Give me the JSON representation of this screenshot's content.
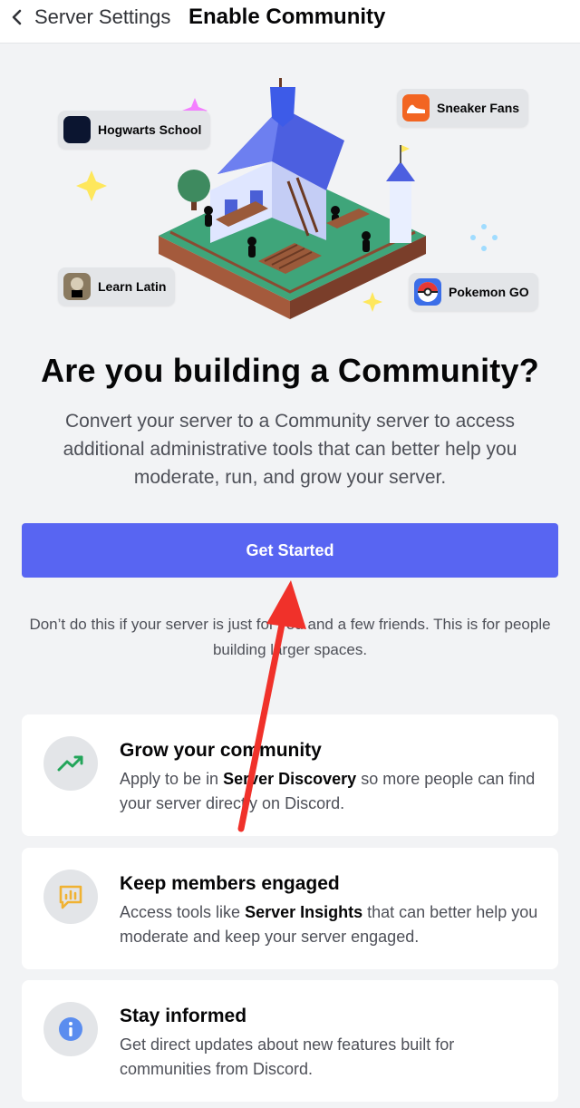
{
  "header": {
    "back_label": "Server Settings",
    "title": "Enable Community"
  },
  "hero": {
    "chips": [
      {
        "label": "Hogwarts School"
      },
      {
        "label": "Sneaker Fans"
      },
      {
        "label": "Learn Latin"
      },
      {
        "label": "Pokemon GO"
      }
    ]
  },
  "main": {
    "headline": "Are you building a Community?",
    "subtext": "Convert your server to a Community server to access additional administrative tools that can better help you moderate, run, and grow your server.",
    "cta_label": "Get Started",
    "note": "Don’t do this if your server is just for you and a few friends. This is for people building larger spaces."
  },
  "features": [
    {
      "title": "Grow your community",
      "desc_pre": "Apply to be in ",
      "desc_bold": "Server Discovery",
      "desc_post": " so more people can find your server directly on Discord."
    },
    {
      "title": "Keep members engaged",
      "desc_pre": "Access tools like ",
      "desc_bold": "Server Insights",
      "desc_post": "  that can better help you moderate and keep your server engaged."
    },
    {
      "title": "Stay informed",
      "desc_pre": "Get direct updates about new features built for communities from Discord.",
      "desc_bold": "",
      "desc_post": ""
    }
  ],
  "colors": {
    "accent": "#5865f2",
    "annotation_arrow": "#f0312a",
    "growth_icon": "#23a55a",
    "engage_icon": "#f0b232",
    "info_icon": "#5b8def"
  },
  "icons": {
    "back": "chevron-left-icon",
    "grow": "trending-up-icon",
    "engage": "chart-message-icon",
    "info": "info-icon"
  }
}
